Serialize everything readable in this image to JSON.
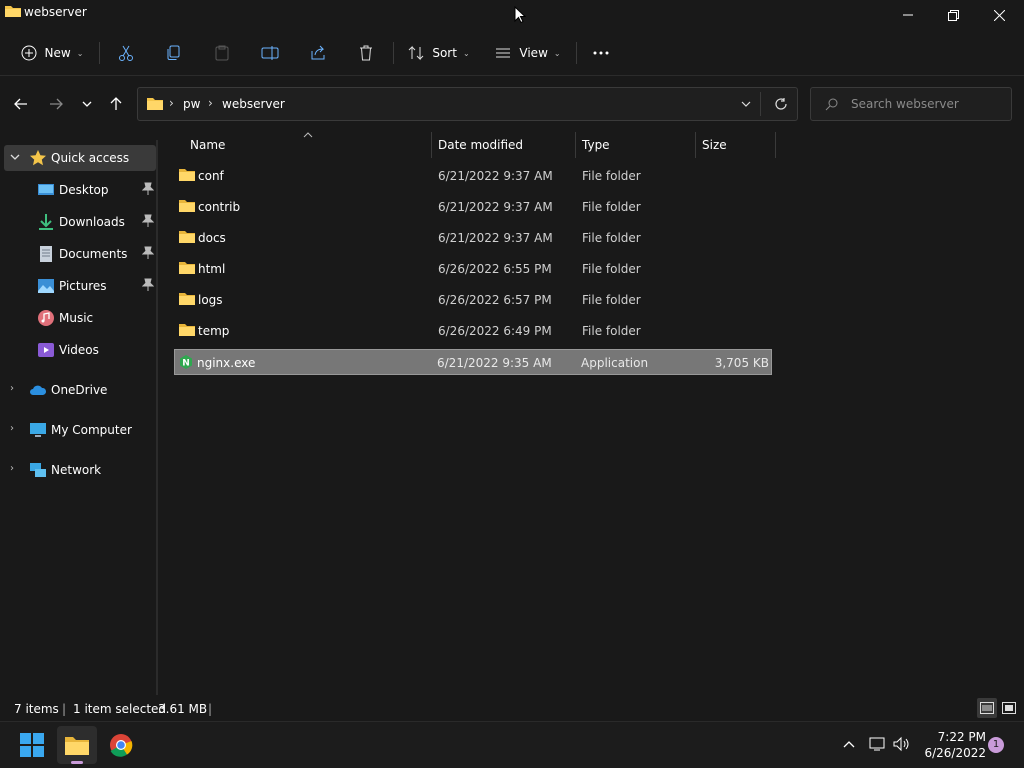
{
  "window": {
    "title": "webserver"
  },
  "toolbar": {
    "new_label": "New",
    "sort_label": "Sort",
    "view_label": "View"
  },
  "address": {
    "crumbs": [
      "pw",
      "webserver"
    ]
  },
  "search": {
    "placeholder": "Search webserver"
  },
  "sidebar": {
    "items": [
      {
        "label": "Quick access",
        "icon": "star-icon",
        "selected": true
      },
      {
        "label": "Desktop",
        "icon": "desktop-icon",
        "pinned": true
      },
      {
        "label": "Downloads",
        "icon": "downloads-icon",
        "pinned": true
      },
      {
        "label": "Documents",
        "icon": "documents-icon",
        "pinned": true
      },
      {
        "label": "Pictures",
        "icon": "pictures-icon",
        "pinned": true
      },
      {
        "label": "Music",
        "icon": "music-icon"
      },
      {
        "label": "Videos",
        "icon": "videos-icon"
      },
      {
        "label": "OneDrive",
        "icon": "cloud-icon"
      },
      {
        "label": "My Computer",
        "icon": "computer-icon"
      },
      {
        "label": "Network",
        "icon": "network-icon"
      }
    ]
  },
  "columns": {
    "name": "Name",
    "date": "Date modified",
    "type": "Type",
    "size": "Size"
  },
  "files": [
    {
      "name": "conf",
      "date": "6/21/2022 9:37 AM",
      "type": "File folder",
      "size": "",
      "icon": "folder-icon"
    },
    {
      "name": "contrib",
      "date": "6/21/2022 9:37 AM",
      "type": "File folder",
      "size": "",
      "icon": "folder-icon"
    },
    {
      "name": "docs",
      "date": "6/21/2022 9:37 AM",
      "type": "File folder",
      "size": "",
      "icon": "folder-icon"
    },
    {
      "name": "html",
      "date": "6/26/2022 6:55 PM",
      "type": "File folder",
      "size": "",
      "icon": "folder-icon"
    },
    {
      "name": "logs",
      "date": "6/26/2022 6:57 PM",
      "type": "File folder",
      "size": "",
      "icon": "folder-icon"
    },
    {
      "name": "temp",
      "date": "6/26/2022 6:49 PM",
      "type": "File folder",
      "size": "",
      "icon": "folder-icon"
    },
    {
      "name": "nginx.exe",
      "date": "6/21/2022 9:35 AM",
      "type": "Application",
      "size": "3,705 KB",
      "icon": "nginx-icon",
      "selected": true
    }
  ],
  "status": {
    "items": "7 items",
    "selected": "1 item selected",
    "size": "3.61 MB"
  },
  "taskbar": {
    "time": "7:22 PM",
    "date": "6/26/2022",
    "notifications": "1"
  },
  "colors": {
    "folder": "#f4c54a",
    "selection": "#777777",
    "background": "#191919",
    "accent": "#4cc2ff"
  }
}
